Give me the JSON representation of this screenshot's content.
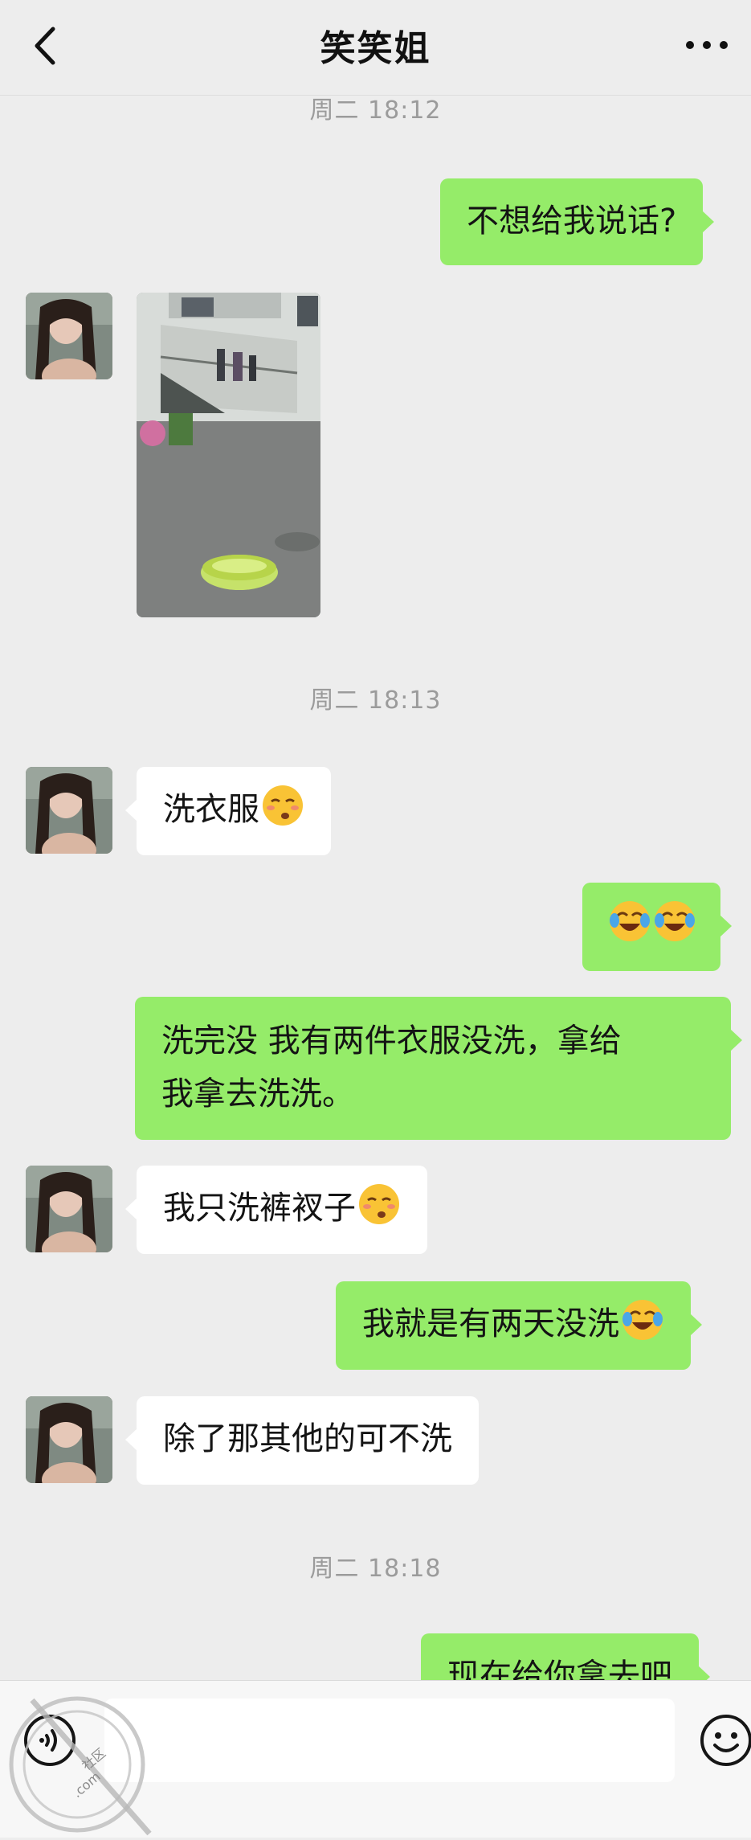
{
  "header": {
    "title": "笑笑姐",
    "back_icon": "chevron-left-icon",
    "more_icon": "ellipsis-icon"
  },
  "messages": {
    "ts1": "周二 18:12",
    "m1": "不想给我说话?",
    "ts2": "周二 18:13",
    "m3": "洗衣服",
    "m5a": "洗完没 我有两件衣服没洗，拿给",
    "m5b": "我拿去洗洗。",
    "m6": "我只洗裤衩子",
    "m7": "我就是有两天没洗",
    "m8": "除了那其他的可不洗",
    "ts3": "周二 18:18",
    "m9": "现在给你拿去吧"
  },
  "input_bar": {
    "voice_icon": "voice-icon",
    "emoji_icon": "emoji-face-icon",
    "input_value": ""
  },
  "watermark": {
    "text": "社区",
    "subtext": ".com"
  },
  "colors": {
    "background": "#ededed",
    "outgoing_bubble": "#95ec69",
    "incoming_bubble": "#ffffff",
    "timestamp": "#9b9b9b"
  }
}
